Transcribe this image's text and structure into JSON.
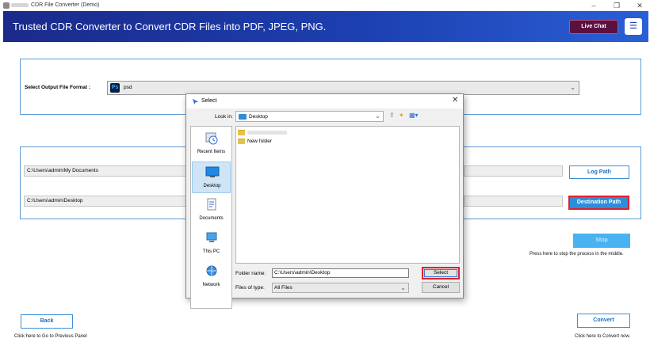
{
  "window": {
    "title": "CDR File Converter (Demo)",
    "minimize_icon": "minimize-icon",
    "restore_icon": "restore-icon",
    "close_icon": "close-icon"
  },
  "header": {
    "headline": "Trusted CDR Converter to Convert CDR Files into PDF, JPEG, PNG.",
    "live_chat_label": "Live Chat",
    "menu_icon": "hamburger-menu-icon",
    "colors": {
      "header_start": "#1b2a8a",
      "header_end": "#2a5fd6",
      "live_chat_bg": "#5c1040"
    }
  },
  "format_panel": {
    "label": "Select Output File Format :",
    "selected_icon_text": "Ps",
    "selected_value": "psd"
  },
  "paths_panel": {
    "log_path_value": "C:\\Users\\admin\\My Documents",
    "destination_path_value": "C:\\Users\\admin\\Desktop",
    "log_path_button": "Log Path",
    "destination_path_button": "Destination Path"
  },
  "stop": {
    "button_label": "Stop",
    "hint": "Press here to stop the process in the middle."
  },
  "footer": {
    "back_label": "Back",
    "back_hint": "Click here to Go to Previous Panel",
    "convert_label": "Convert",
    "convert_hint": "Click here to Convert now."
  },
  "dialog": {
    "title": "Select",
    "look_in_label": "Look in:",
    "look_in_value": "Desktop",
    "places": [
      {
        "label": "Recent Items",
        "icon": "recent-items-icon"
      },
      {
        "label": "Desktop",
        "icon": "desktop-icon"
      },
      {
        "label": "Documents",
        "icon": "documents-icon"
      },
      {
        "label": "This PC",
        "icon": "this-pc-icon"
      },
      {
        "label": "Network",
        "icon": "network-icon"
      }
    ],
    "files": [
      {
        "name": "New folder",
        "icon": "folder-icon"
      }
    ],
    "folder_name_label": "Folder name:",
    "folder_name_value": "C:\\Users\\admin\\Desktop",
    "files_of_type_label": "Files of type:",
    "files_of_type_value": "All Files",
    "select_button": "Select",
    "cancel_button": "Cancel"
  }
}
